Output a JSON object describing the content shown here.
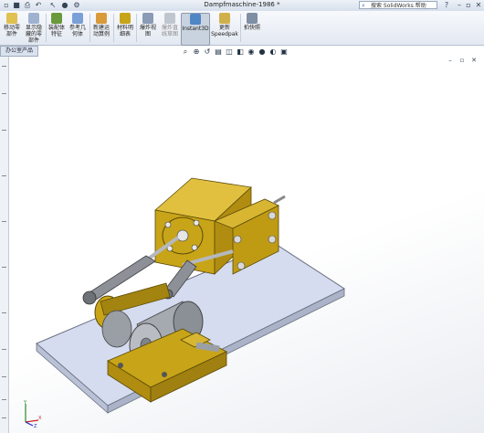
{
  "title_bar": {
    "document_title": "Dampfmaschine-1986 *",
    "search_placeholder": "搜索 SolidWorks 帮助",
    "quick_access_icons": [
      "new-document-icon",
      "open-icon",
      "save-icon",
      "print-icon",
      "undo-icon",
      "select-pointer-icon",
      "rebuild-icon",
      "options-icon"
    ],
    "right_icons": [
      "search-icon",
      "help-icon",
      "minimize-icon",
      "restore-icon",
      "close-icon"
    ]
  },
  "ribbon": {
    "buttons": [
      {
        "label": "移动零部件",
        "icon": "move-component-icon"
      },
      {
        "label": "显示隐藏的零部件",
        "icon": "show-hidden-icon"
      },
      {
        "label": "装配体特征",
        "icon": "assembly-feature-icon"
      },
      {
        "label": "参考几何体",
        "icon": "reference-geometry-icon"
      },
      {
        "label": "新建运动算例",
        "icon": "new-motion-study-icon"
      },
      {
        "label": "材料明细表",
        "icon": "bill-of-materials-icon"
      },
      {
        "label": "爆炸视图",
        "icon": "exploded-view-icon"
      },
      {
        "label": "爆炸直线草图",
        "icon": "explode-line-sketch-icon"
      },
      {
        "label": "Instant3D",
        "icon": "instant3d-icon"
      },
      {
        "label": "更新 Speedpak",
        "icon": "speedpak-icon"
      },
      {
        "label": "拍快照",
        "icon": "snapshot-icon"
      }
    ]
  },
  "command_tab": {
    "label": "办公室产品"
  },
  "heads_up_toolbar": [
    "zoom-to-fit-icon",
    "zoom-area-icon",
    "previous-view-icon",
    "section-view-icon",
    "view-orientation-icon",
    "display-style-icon",
    "hide-show-icon",
    "edit-appearance-icon",
    "scene-icon",
    "view-settings-icon"
  ],
  "window_controls": [
    "minimize-icon",
    "restore-icon",
    "close-icon"
  ],
  "colors": {
    "part_gold": "#c8a418",
    "part_dark_gold": "#8e7208",
    "steel": "#9a9fa6",
    "base_plate": "#d5dcef",
    "background": "#ffffff"
  }
}
